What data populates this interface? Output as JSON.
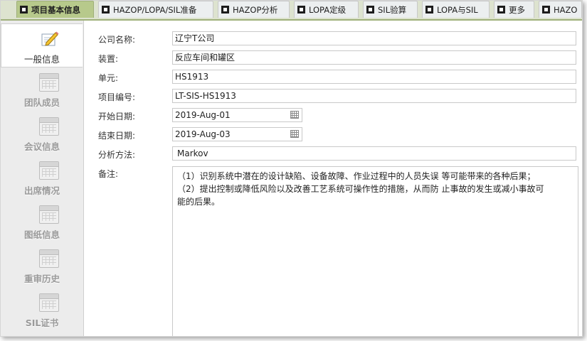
{
  "tabs": [
    {
      "label": "项目基本信息",
      "active": true
    },
    {
      "label": "HAZOP/LOPA/SIL准备"
    },
    {
      "label": "HAZOP分析"
    },
    {
      "label": "LOPA定级"
    },
    {
      "label": "SIL验算"
    },
    {
      "label": "LOPA与SIL"
    },
    {
      "label": "更多"
    },
    {
      "label": "HAZO"
    }
  ],
  "sidebar": {
    "items": [
      {
        "label": "一般信息",
        "icon": "edit-icon",
        "active": true
      },
      {
        "label": "团队成员",
        "icon": "table-icon"
      },
      {
        "label": "会议信息",
        "icon": "table-icon"
      },
      {
        "label": "出席情况",
        "icon": "table-icon"
      },
      {
        "label": "图纸信息",
        "icon": "table-icon"
      },
      {
        "label": "重审历史",
        "icon": "table-icon"
      },
      {
        "label": "SIL证书",
        "icon": "table-icon"
      }
    ]
  },
  "form": {
    "company_label": "公司名称:",
    "company_value": "辽宁T公司",
    "device_label": "装置:",
    "device_value": "反应车间和罐区",
    "unit_label": "单元:",
    "unit_value": "HS1913",
    "project_no_label": "项目编号:",
    "project_no_value": "LT-SIS-HS1913",
    "start_label": "开始日期:",
    "start_value": "2019-Aug-01",
    "end_label": "结束日期:",
    "end_value": "2019-Aug-03",
    "method_label": "分析方法:",
    "method_value": "Markov",
    "notes_label": "备注:",
    "notes_lines": [
      "（1）识别系统中潜在的设计缺陷、设备故障、作业过程中的人员失误 等可能带来的各种后果；",
      "（2）提出控制或降低风险以及改善工艺系统可操作性的措施，从而防 止事故的发生或减小事故可",
      "能的后果。"
    ]
  },
  "colors": {
    "active_tab": "#b7c98b",
    "tabbar": "#dde3cf"
  }
}
